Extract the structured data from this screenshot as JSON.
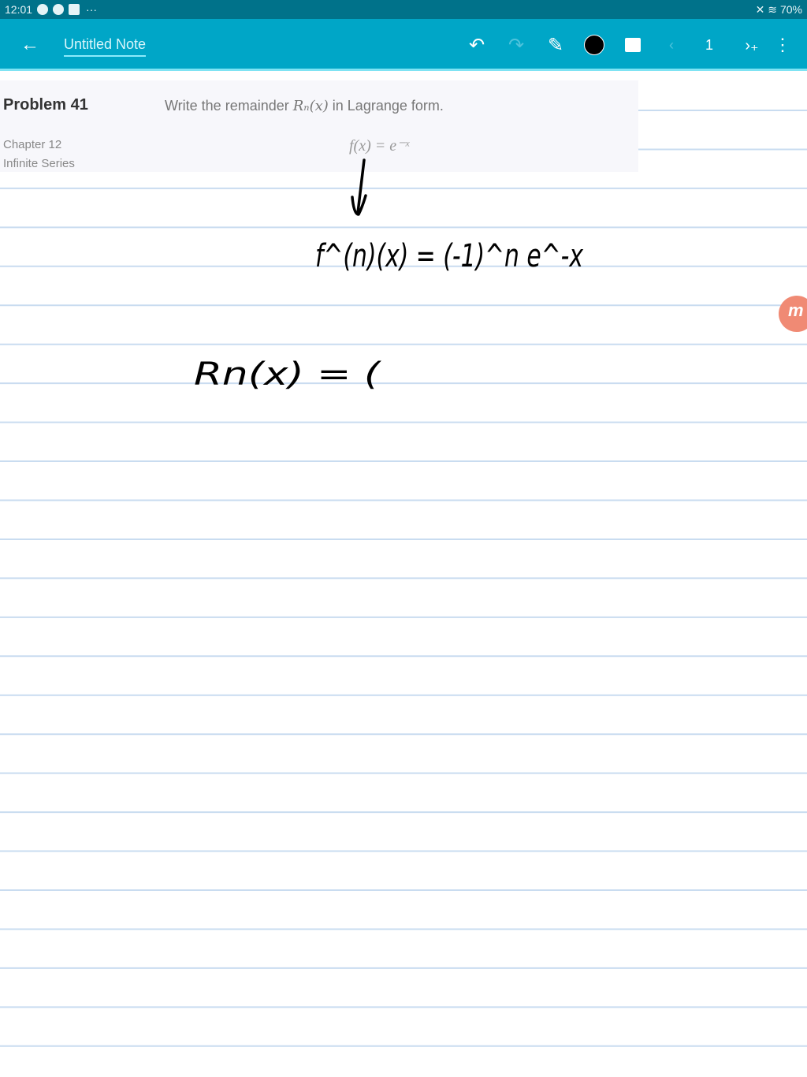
{
  "status_bar": {
    "time": "12:01",
    "more": "···",
    "battery": "70%"
  },
  "toolbar": {
    "title": "Untitled Note",
    "page_number": "1",
    "pen_color": "#000000"
  },
  "problem": {
    "title": "Problem 41",
    "chapter": "Chapter 12",
    "section": "Infinite Series",
    "question_prefix": "Write the remainder ",
    "question_math": "Rₙ(x)",
    "question_suffix": " in Lagrange form.",
    "function": "f(x) = e⁻ˣ"
  },
  "handwriting": {
    "line1": "f^(n)(x) = (-1)^n e^-x",
    "line2": "Rn(x) = ("
  },
  "badge": {
    "letter": "m"
  },
  "colors": {
    "toolbar": "#00a6c7",
    "status": "#00728a",
    "rule": "#c9dcf0",
    "badge": "#f08a74"
  }
}
